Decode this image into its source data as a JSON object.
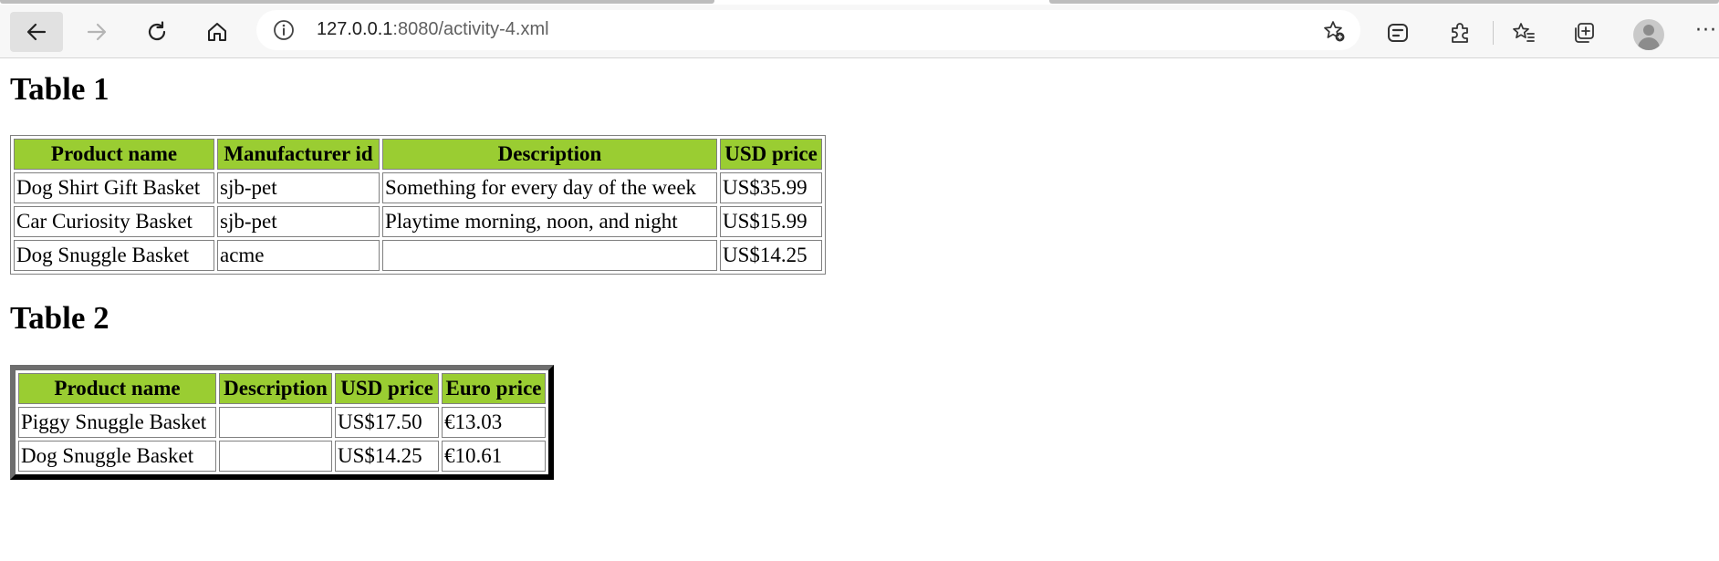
{
  "browser": {
    "url_host": "127.0.0.1",
    "url_rest": ":8080/activity-4.xml",
    "icons": [
      "back-arrow-icon",
      "forward-arrow-icon",
      "refresh-icon",
      "home-icon",
      "info-icon",
      "add-favorite-icon",
      "copilot-icon",
      "extensions-icon",
      "favorites-icon",
      "collections-icon",
      "profile-icon",
      "more-icon"
    ],
    "more_label": "···"
  },
  "table1": {
    "heading": "Table 1",
    "columns": [
      "Product name",
      "Manufacturer id",
      "Description",
      "USD price"
    ],
    "rows": [
      [
        "Dog Shirt Gift Basket",
        "sjb-pet",
        "Something for every day of the week",
        "US$35.99"
      ],
      [
        "Car Curiosity Basket",
        "sjb-pet",
        "Playtime morning, noon, and night",
        "US$15.99"
      ],
      [
        "Dog Snuggle Basket",
        "acme",
        "",
        "US$14.25"
      ]
    ]
  },
  "table2": {
    "heading": "Table 2",
    "columns": [
      "Product name",
      "Description",
      "USD price",
      "Euro price"
    ],
    "rows": [
      [
        "Piggy Snuggle Basket",
        "",
        "US$17.50",
        "€13.03"
      ],
      [
        "Dog Snuggle Basket",
        "",
        "US$14.25",
        "€10.61"
      ]
    ]
  },
  "colors": {
    "header_bg": "#9acd32"
  }
}
